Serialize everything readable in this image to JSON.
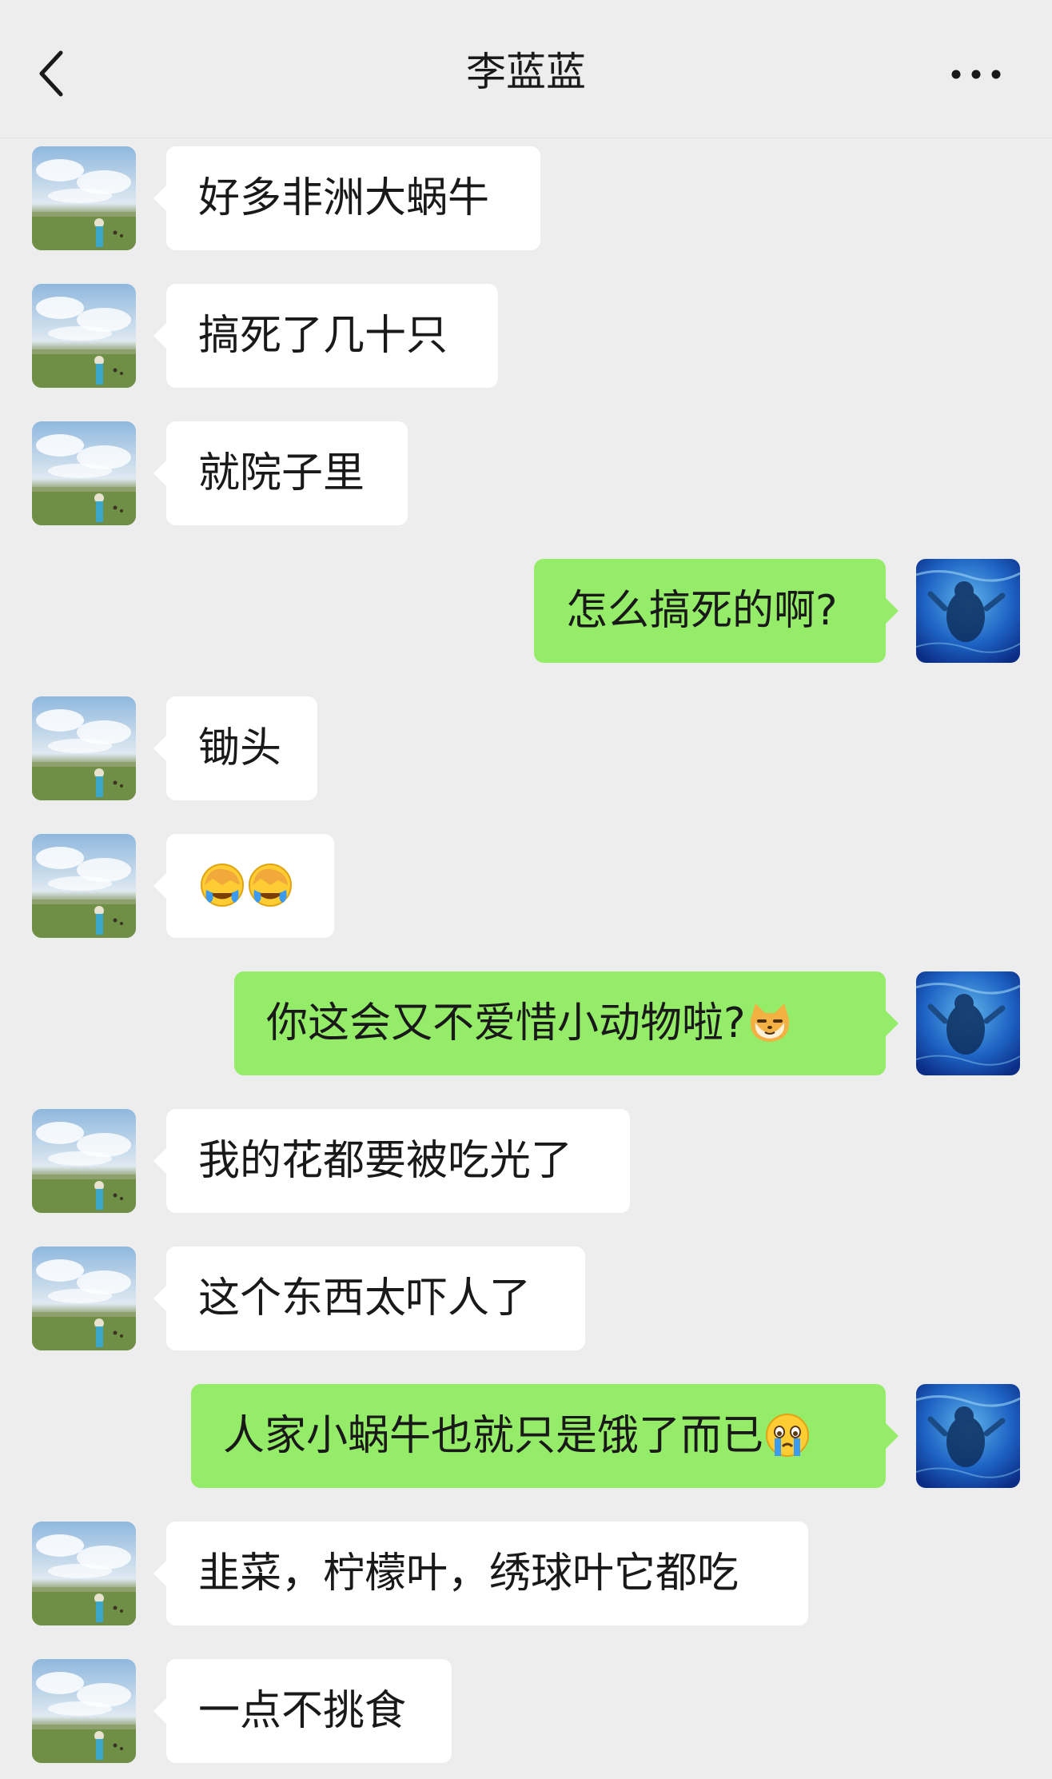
{
  "header": {
    "title": "李蓝蓝",
    "back_icon": "chevron-left-icon",
    "more_icon": "more-dots-icon"
  },
  "colors": {
    "background": "#ededed",
    "incoming_bubble": "#ffffff",
    "outgoing_bubble": "#95ec69",
    "text": "#191919"
  },
  "messages": [
    {
      "from": "contact",
      "text": "好多非洲大蜗牛"
    },
    {
      "from": "contact",
      "text": "搞死了几十只"
    },
    {
      "from": "contact",
      "text": "就院子里"
    },
    {
      "from": "me",
      "text": "怎么搞死的啊?"
    },
    {
      "from": "contact",
      "text": "锄头"
    },
    {
      "from": "contact",
      "text": "",
      "emoji": [
        "facepalm-cry-emoji",
        "facepalm-cry-emoji"
      ]
    },
    {
      "from": "me",
      "text": "你这会又不爱惜小动物啦?",
      "emoji": [
        "doge-cat-emoji"
      ]
    },
    {
      "from": "contact",
      "text": "我的花都要被吃光了"
    },
    {
      "from": "contact",
      "text": "这个东西太吓人了"
    },
    {
      "from": "me",
      "text": "人家小蜗牛也就只是饿了而已",
      "emoji": [
        "crying-face-emoji"
      ]
    },
    {
      "from": "contact",
      "text": "韭菜，柠檬叶，绣球叶它都吃"
    },
    {
      "from": "contact",
      "text": "一点不挑食"
    }
  ]
}
